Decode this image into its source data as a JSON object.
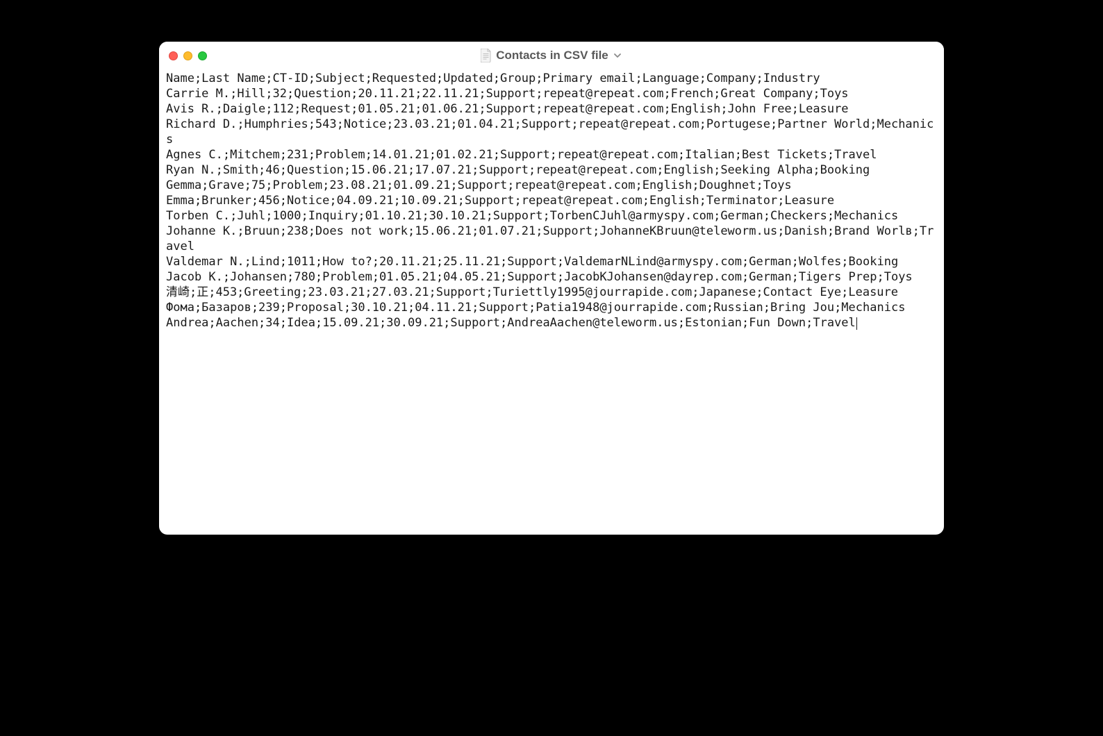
{
  "window": {
    "title": "Contacts in CSV file"
  },
  "csv": {
    "header": [
      "Name",
      "Last Name",
      "CT-ID",
      "Subject",
      "Requested",
      "Updated",
      "Group",
      "Primary email",
      "Language",
      "Company",
      "Industry"
    ],
    "rows": [
      [
        "Carrie M.",
        "Hill",
        "32",
        "Question",
        "20.11.21",
        "22.11.21",
        "Support",
        "repeat@repeat.com",
        "French",
        "Great Company",
        "Toys"
      ],
      [
        "Avis R.",
        "Daigle",
        "112",
        "Request",
        "01.05.21",
        "01.06.21",
        "Support",
        "repeat@repeat.com",
        "English",
        "John Free",
        "Leasure"
      ],
      [
        "Richard D.",
        "Humphries",
        "543",
        "Notice",
        "23.03.21",
        "01.04.21",
        "Support",
        "repeat@repeat.com",
        "Portugese",
        "Partner World",
        "Mechanics"
      ],
      [
        "Agnes C.",
        "Mitchem",
        "231",
        "Problem",
        "14.01.21",
        "01.02.21",
        "Support",
        "repeat@repeat.com",
        "Italian",
        "Best Tickets",
        "Travel"
      ],
      [
        "Ryan N.",
        "Smith",
        "46",
        "Question",
        "15.06.21",
        "17.07.21",
        "Support",
        "repeat@repeat.com",
        "English",
        "Seeking Alpha",
        "Booking"
      ],
      [
        "Gemma",
        "Grave",
        "75",
        "Problem",
        "23.08.21",
        "01.09.21",
        "Support",
        "repeat@repeat.com",
        "English",
        "Doughnet",
        "Toys"
      ],
      [
        "Emma",
        "Brunker",
        "456",
        "Notice",
        "04.09.21",
        "10.09.21",
        "Support",
        "repeat@repeat.com",
        "English",
        "Terminator",
        "Leasure"
      ],
      [
        "Torben C.",
        "Juhl",
        "1000",
        "Inquiry",
        "01.10.21",
        "30.10.21",
        "Support",
        "TorbenCJuhl@armyspy.com",
        "German",
        "Checkers",
        "Mechanics"
      ],
      [
        "Johanne K.",
        "Bruun",
        "238",
        "Does not work",
        "15.06.21",
        "01.07.21",
        "Support",
        "JohanneKBruun@teleworm.us",
        "Danish",
        "Brand Worlв",
        "Travel"
      ],
      [
        "Valdemar N.",
        "Lind",
        "1011",
        "How to?",
        "20.11.21",
        "25.11.21",
        "Support",
        "ValdemarNLind@armyspy.com",
        "German",
        "Wolfes",
        "Booking"
      ],
      [
        "Jacob K.",
        "Johansen",
        "780",
        "Problem",
        "01.05.21",
        "04.05.21",
        "Support",
        "JacobKJohansen@dayrep.com",
        "German",
        "Tigers Prep",
        "Toys"
      ],
      [
        "清崎",
        "正",
        "453",
        "Greeting",
        "23.03.21",
        "27.03.21",
        "Support",
        "Turiettly1995@jourrapide.com",
        "Japanese",
        "Contact Eye",
        "Leasure"
      ],
      [
        "Фома",
        "Базаров",
        "239",
        "Proposal",
        "30.10.21",
        "04.11.21",
        "Support",
        "Patia1948@jourrapide.com",
        "Russian",
        "Bring Jou",
        "Mechanics"
      ],
      [
        "Andrea",
        "Aachen",
        "34",
        "Idea",
        "15.09.21",
        "30.09.21",
        "Support",
        "AndreaAachen@teleworm.us",
        "Estonian",
        "Fun Down",
        "Travel"
      ]
    ]
  }
}
